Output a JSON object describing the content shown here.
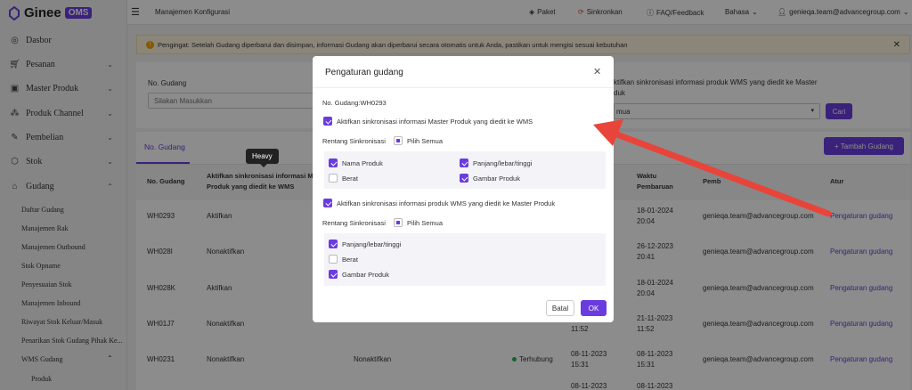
{
  "brand": {
    "name": "Ginee",
    "badge": "OMS"
  },
  "topbar": {
    "page_title": "Manajemen Konfigurasi",
    "paket": "Paket",
    "sinkronkan": "Sinkronkan",
    "faq": "FAQ/Feedback",
    "bahasa": "Bahasa",
    "user": "genieqa.team@advancegroup.com"
  },
  "sidebar": {
    "items": [
      {
        "label": "Dasbor"
      },
      {
        "label": "Pesanan"
      },
      {
        "label": "Master Produk"
      },
      {
        "label": "Produk Channel"
      },
      {
        "label": "Pembelian"
      },
      {
        "label": "Stok"
      },
      {
        "label": "Gudang"
      }
    ],
    "subitems": [
      {
        "label": "Daftar Gudang"
      },
      {
        "label": "Manajemen Rak"
      },
      {
        "label": "Manajemen Outbound"
      },
      {
        "label": "Stok Opname"
      },
      {
        "label": "Penyesuaian Stok"
      },
      {
        "label": "Manajemen Inbound"
      },
      {
        "label": "Riwayat Stok Keluar/Masuk"
      },
      {
        "label": "Penarikan Stok Gudang Pihak Ke..."
      },
      {
        "label": "WMS Gudang"
      },
      {
        "label": "Produk"
      }
    ]
  },
  "warning": "Pengingat: Setelah Gudang diperbarui dan disimpan, informasi Gudang akan diperbarui secara otomatis untuk Anda, pastikan untuk mengisi sesuai kebutuhan",
  "filter": {
    "label_gudang": "No. Gudang",
    "placeholder": "Silakan Masukkan",
    "label_sync": "ktifkan sinkronisasi informasi produk WMS yang diedit ke Master",
    "label_sync2": "duk",
    "select_value": "mua",
    "cari": "Cari"
  },
  "tabs": {
    "tab1": "No. Gudang",
    "add": "+ Tambah Gudang"
  },
  "tooltip": "Heavy",
  "table": {
    "headers": {
      "no": "No. Gudang",
      "aktif1": "Aktifkan sinkronisasi informasi M",
      "aktif2": "Produk yang diedit ke WMS",
      "waktu1": "Waktu",
      "waktu2": "Pembaruan",
      "pemb": "Pemb",
      "atur": "Atur"
    },
    "rows": [
      {
        "no": "WH0293",
        "sync": "Aktifkan",
        "sync2": "",
        "status": "",
        "date1": "",
        "time1": "",
        "date2": "18-01-2024",
        "time2": "20:04",
        "pemb": "genieqa.team@advancegroup.com",
        "action": "Pengaturan gudang"
      },
      {
        "no": "WH028I",
        "sync": "Nonaktifkan",
        "sync2": "",
        "status": "",
        "date1": "",
        "time1": "",
        "date2": "26-12-2023",
        "time2": "20:41",
        "pemb": "genieqa.team@advancegroup.com",
        "action": "Pengaturan gudang"
      },
      {
        "no": "WH028K",
        "sync": "Aktifkan",
        "sync2": "",
        "status": "",
        "date1": "",
        "time1": "",
        "date2": "18-01-2024",
        "time2": "20:04",
        "pemb": "genieqa.team@advancegroup.com",
        "action": "Pengaturan gudang"
      },
      {
        "no": "WH01J7",
        "sync": "Nonaktifkan",
        "sync2": "",
        "status": "",
        "date1": "",
        "time1": "11:52",
        "date2": "21-11-2023",
        "time2": "11:52",
        "pemb": "genieqa.team@advancegroup.com",
        "action": "Pengaturan gudang"
      },
      {
        "no": "WH0231",
        "sync": "Nonaktifkan",
        "sync2": "Nonaktifkan",
        "status": "Terhubung",
        "date1": "08-11-2023",
        "time1": "15:31",
        "date2": "08-11-2023",
        "time2": "15:31",
        "pemb": "genieqa.team@advancegroup.com",
        "action": "Pengaturan gudang"
      }
    ],
    "lastrow_date1": "08-11-2023",
    "lastrow_date2": "08-11-2023"
  },
  "modal": {
    "title": "Pengaturan gudang",
    "no_gudang": "No. Gudang:WH0293",
    "section1": "Aktifkan sinkronisasi informasi Master Produk yang diedit ke WMS",
    "range_label": "Rentang Sinkronisasi",
    "select_all": "Pilih Semua",
    "s1_opts": {
      "nama": "Nama Produk",
      "berat": "Berat",
      "pltinggi": "Panjang/lebar/tinggi",
      "gambar": "Gambar Produk"
    },
    "section2": "Aktifkan sinkronisasi informasi produk WMS yang diedit ke Master Produk",
    "s2_opts": {
      "pltinggi": "Panjang/lebar/tinggi",
      "berat": "Berat",
      "gambar": "Gambar Produk"
    },
    "cancel": "Batal",
    "ok": "OK"
  },
  "colors": {
    "accent": "#6a3ce0",
    "arrow": "#e8443a",
    "link": "#6a3ce0",
    "status_green": "#2bb24c"
  }
}
